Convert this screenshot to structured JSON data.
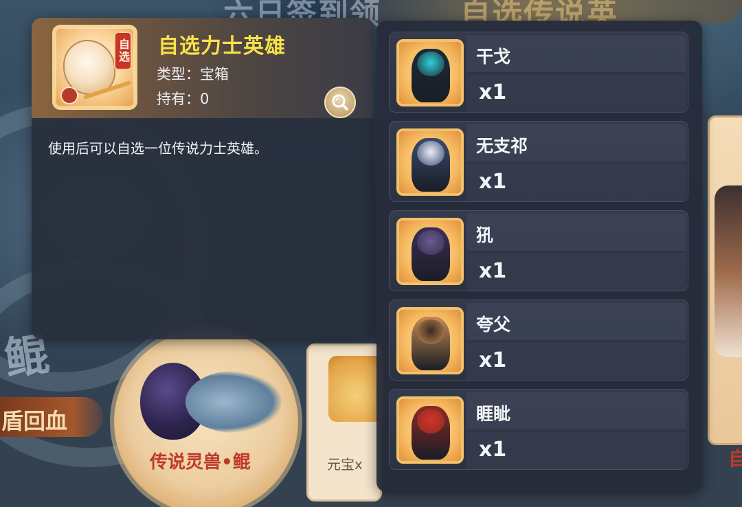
{
  "background": {
    "banner_text_left": "六日签到领",
    "banner_text_right": "自选传说英",
    "left_tag": "盾回血",
    "left_title_char": "鲲",
    "ring_label": "传说灵兽•鲲",
    "card_text": "元宝x",
    "right_label": "自"
  },
  "detail": {
    "select_tag": "自选",
    "name": "自选力士英雄",
    "type_text": "类型：宝箱",
    "owned_text": "持有：0",
    "description": "使用后可以自选一位传说力士英雄。",
    "magnifier_icon": "magnifier-icon"
  },
  "heroes": [
    {
      "name": "干戈",
      "qty": "x1",
      "accent": "#2fd0d8",
      "body": "#1d2a36"
    },
    {
      "name": "无支祁",
      "qty": "x1",
      "accent": "#e8eef6",
      "body": "#3a4a70"
    },
    {
      "name": "犼",
      "qty": "x1",
      "accent": "#6b5a8e",
      "body": "#3a2f55"
    },
    {
      "name": "夸父",
      "qty": "x1",
      "accent": "#3a2a22",
      "body": "#c58a52"
    },
    {
      "name": "睚眦",
      "qty": "x1",
      "accent": "#d2342a",
      "body": "#8a2a24"
    }
  ]
}
